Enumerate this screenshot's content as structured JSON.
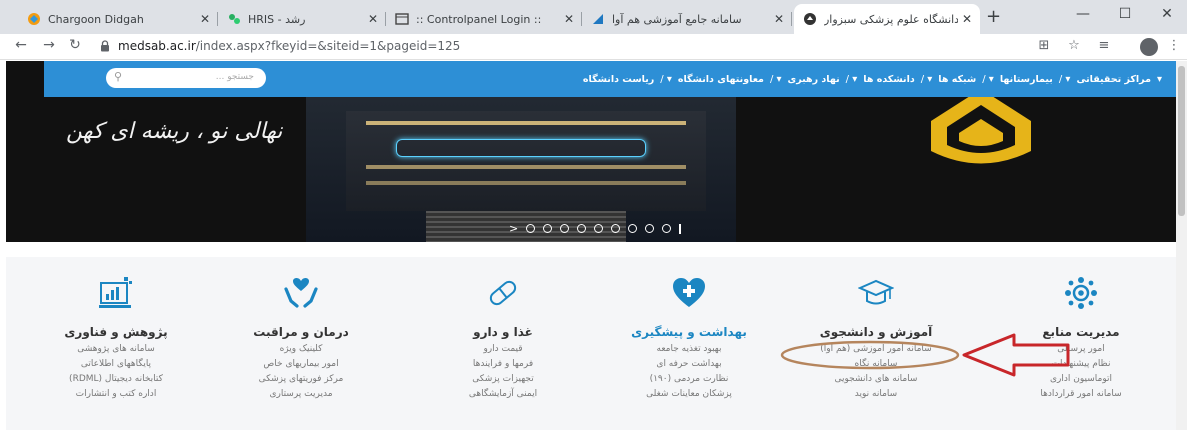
{
  "browser": {
    "tabs": [
      {
        "title": "Chargoon Didgah",
        "favicon": "chargoon-icon",
        "active": false
      },
      {
        "title": "HRIS - رشد",
        "favicon": "hris-icon",
        "active": false
      },
      {
        "title": ":: Controlpanel Login ::",
        "favicon": "controlpanel-icon",
        "active": false
      },
      {
        "title": "سامانه جامع آموزشی هم آوا",
        "favicon": "hamava-icon",
        "active": false
      },
      {
        "title": "دانشگاه علوم پزشکی سبزوار",
        "favicon": "university-icon",
        "active": true
      }
    ],
    "new_tab": "+",
    "url_host": "medsab.ac.ir",
    "url_path": "/index.aspx?fkeyid=&siteid=1&pageid=125"
  },
  "site": {
    "nav": [
      "ریاست دانشگاه",
      "معاونتهای دانشگاه",
      "نهاد رهبری",
      "دانشکده ها",
      "شبکه ها",
      "بیمارستانها",
      "مراکز تحقیقاتی"
    ],
    "nav_separator": "/",
    "search_placeholder": "جستجو ...",
    "slogan": "نهالی نو ، ریشه ای کهن",
    "slider_arrow": ">",
    "slider_dot_count": 9,
    "columns": [
      {
        "title": "مدیریت منابع",
        "icon": "network-people-icon",
        "highlight": false,
        "links": [
          "امور پرسنلی",
          "نظام پیشنهادات",
          "اتوماسیون اداری",
          "سامانه امور قراردادها"
        ]
      },
      {
        "title": "آموزش و دانشجوی",
        "icon": "graduation-cap-icon",
        "highlight": false,
        "links": [
          "سامانه امور آموزشی (هم آوا)",
          "سامانه نگاه",
          "سامانه های دانشجویی",
          "سامانه نوید"
        ]
      },
      {
        "title": "بهداشت و پیشگیری",
        "icon": "heart-plus-icon",
        "highlight": true,
        "links": [
          "بهبود تغذیه جامعه",
          "بهداشت حرفه ای",
          "نظارت مردمی (۱۹۰)",
          "پزشکان معاینات شغلی"
        ]
      },
      {
        "title": "غذا و دارو",
        "icon": "pill-icon",
        "highlight": false,
        "links": [
          "قیمت دارو",
          "فرمها و فرایندها",
          "تجهیزات پزشکی",
          "ایمنی آزمایشگاهی"
        ]
      },
      {
        "title": "درمان و مراقبت",
        "icon": "caring-hands-icon",
        "highlight": false,
        "links": [
          "کلینیک ویژه",
          "امور بیماریهای خاص",
          "مرکز فوریتهای پزشکی",
          "مدیریت پرستاری"
        ]
      },
      {
        "title": "پژوهش و فناوری",
        "icon": "research-chart-icon",
        "highlight": false,
        "links": [
          "سامانه های پژوهشی",
          "پایگاههای اطلاعاتی",
          "کتابخانه دیجیتال (RDML)",
          "اداره کتب و انتشارات"
        ]
      }
    ]
  },
  "colors": {
    "navbar": "#2d8fd6",
    "highlight_title": "#1b86c2",
    "annotation_red": "#c8262a",
    "annotation_circle": "#b5855d"
  }
}
